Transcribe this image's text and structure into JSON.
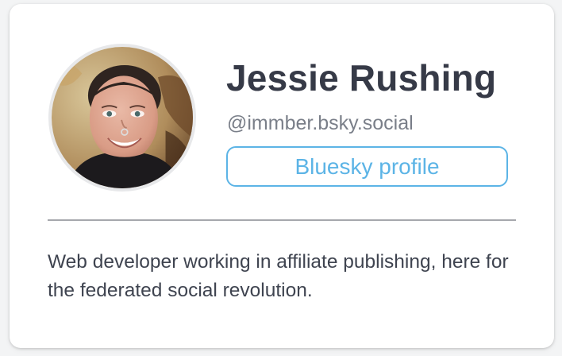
{
  "profile": {
    "display_name": "Jessie Rushing",
    "handle": "@immber.bsky.social",
    "profile_button_label": "Bluesky profile",
    "bio": "Web developer working in affiliate publishing, here for the federated social revolution.",
    "avatar": "avatar-photo"
  },
  "colors": {
    "accent": "#5cb4e6",
    "name_text": "#363a47",
    "handle_text": "#7a7f89",
    "bio_text": "#3f4450"
  }
}
